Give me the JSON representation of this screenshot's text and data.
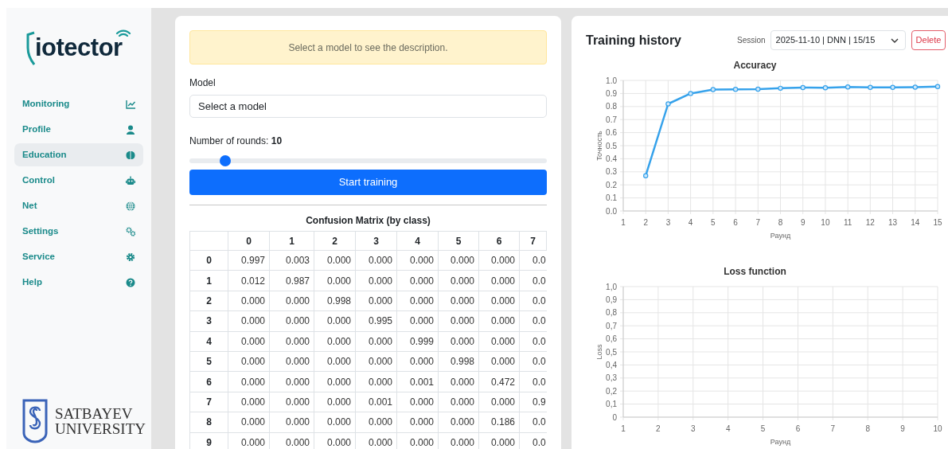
{
  "sidebar": {
    "logo": "iotector",
    "items": [
      {
        "label": "Monitoring",
        "selected": false
      },
      {
        "label": "Profile",
        "selected": false
      },
      {
        "label": "Education",
        "selected": true
      },
      {
        "label": "Control",
        "selected": false
      },
      {
        "label": "Net",
        "selected": false
      },
      {
        "label": "Settings",
        "selected": false
      },
      {
        "label": "Service",
        "selected": false
      },
      {
        "label": "Help",
        "selected": false
      }
    ],
    "university": [
      "SATBAYEV",
      "UNIVERSITY"
    ]
  },
  "training_form": {
    "notice": "Select a model to see the description.",
    "model": {
      "label": "Model",
      "placeholder": "Select a model"
    },
    "rounds": {
      "label": "Number of rounds: **10**",
      "level": 0.1
    },
    "start_button": "Start training"
  },
  "confusion_matrix": {
    "title": "Confusion Matrix (by class)",
    "columns": [
      "0",
      "1",
      "2",
      "3",
      "4",
      "5",
      "6",
      "7"
    ],
    "rows": [
      {
        "label": "0",
        "cells": [
          "0.997",
          "0.003",
          "0.000",
          "0.000",
          "0.000",
          "0.000",
          "0.000",
          "0.0"
        ]
      },
      {
        "label": "1",
        "cells": [
          "0.012",
          "0.987",
          "0.000",
          "0.000",
          "0.000",
          "0.000",
          "0.000",
          "0.0"
        ]
      },
      {
        "label": "2",
        "cells": [
          "0.000",
          "0.000",
          "0.998",
          "0.000",
          "0.000",
          "0.000",
          "0.000",
          "0.0"
        ]
      },
      {
        "label": "3",
        "cells": [
          "0.000",
          "0.000",
          "0.000",
          "0.995",
          "0.000",
          "0.000",
          "0.000",
          "0.0"
        ]
      },
      {
        "label": "4",
        "cells": [
          "0.000",
          "0.000",
          "0.000",
          "0.000",
          "0.999",
          "0.000",
          "0.000",
          "0.0"
        ]
      },
      {
        "label": "5",
        "cells": [
          "0.000",
          "0.000",
          "0.000",
          "0.000",
          "0.000",
          "0.998",
          "0.000",
          "0.0"
        ]
      },
      {
        "label": "6",
        "cells": [
          "0.000",
          "0.000",
          "0.000",
          "0.000",
          "0.001",
          "0.000",
          "0.472",
          "0.0"
        ]
      },
      {
        "label": "7",
        "cells": [
          "0.000",
          "0.000",
          "0.000",
          "0.001",
          "0.000",
          "0.000",
          "0.000",
          "0.9"
        ]
      },
      {
        "label": "8",
        "cells": [
          "0.000",
          "0.000",
          "0.000",
          "0.000",
          "0.000",
          "0.000",
          "0.186",
          "0.0"
        ]
      },
      {
        "label": "9",
        "cells": [
          "0.000",
          "0.000",
          "0.000",
          "0.000",
          "0.000",
          "0.000",
          "0.000",
          "0.0"
        ]
      }
    ]
  },
  "history": {
    "title": "Training history",
    "session": {
      "label": "Session",
      "value": "2025-11-10 | DNN | 15/15"
    },
    "delete_button": "Delete",
    "accuracy": {
      "chart_data": {
        "type": "line",
        "title": "Accuracy",
        "xlabel": "Раунд",
        "ylabel": "Точность",
        "grid": true,
        "x": [
          2,
          3,
          4,
          5,
          6,
          7,
          8,
          9,
          10,
          11,
          12,
          13,
          14,
          15
        ],
        "series": [
          {
            "color": "#36a2eb",
            "marker": true,
            "values": [
              0.27,
              0.82,
              0.9,
              0.93,
              0.932,
              0.933,
              0.94,
              0.945,
              0.944,
              0.95,
              0.947,
              0.947,
              0.948,
              0.953
            ]
          }
        ],
        "xlim": [
          1,
          15
        ],
        "ylim": [
          0,
          1
        ],
        "xticks": [
          1,
          2,
          3,
          4,
          5,
          6,
          7,
          8,
          9,
          10,
          11,
          12,
          13,
          14,
          15
        ],
        "yticks": [
          {
            "value": 0,
            "label": "0.0"
          },
          {
            "value": 0.1,
            "label": "0.1"
          },
          {
            "value": 0.2,
            "label": "0.2"
          },
          {
            "value": 0.3,
            "label": "0.3"
          },
          {
            "value": 0.4,
            "label": "0.4"
          },
          {
            "value": 0.5,
            "label": "0.5"
          },
          {
            "value": 0.6,
            "label": "0.6"
          },
          {
            "value": 0.7,
            "label": "0.7"
          },
          {
            "value": 0.8,
            "label": "0.8"
          },
          {
            "value": 0.9,
            "label": "0.9"
          },
          {
            "value": 1,
            "label": "1.0"
          }
        ]
      }
    },
    "loss": {
      "chart_data": {
        "type": "line",
        "title": "Loss function",
        "xlabel": "Раунд",
        "ylabel": "Loss",
        "grid": true,
        "xlim": [
          1,
          10
        ],
        "ylim": [
          0,
          1
        ],
        "xticks": [
          1,
          2,
          3,
          4,
          5,
          6,
          7,
          8,
          9,
          10
        ],
        "yticks": [
          {
            "value": 0,
            "label": "0"
          },
          {
            "value": 0.1,
            "label": "0,1"
          },
          {
            "value": 0.2,
            "label": "0,2"
          },
          {
            "value": 0.3,
            "label": "0,3"
          },
          {
            "value": 0.4,
            "label": "0,4"
          },
          {
            "value": 0.5,
            "label": "0,5"
          },
          {
            "value": 0.6,
            "label": "0,6"
          },
          {
            "value": 0.7,
            "label": "0,7"
          },
          {
            "value": 0.8,
            "label": "0,8"
          },
          {
            "value": 0.9,
            "label": "0,9"
          },
          {
            "value": 1,
            "label": "1,0"
          }
        ]
      }
    }
  }
}
